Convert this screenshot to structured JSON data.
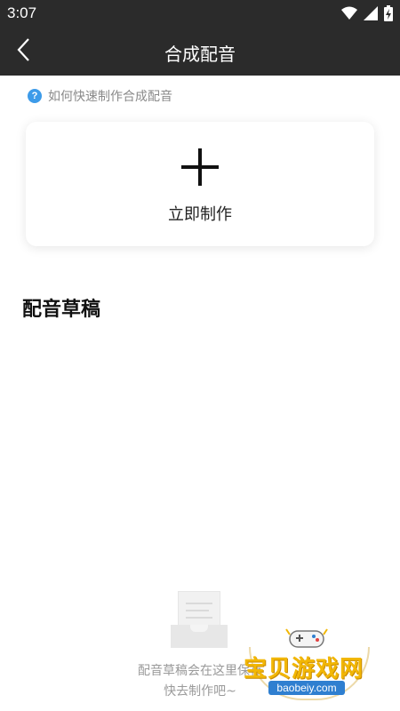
{
  "status_bar": {
    "time": "3:07",
    "icons": [
      "wifi-icon",
      "cellular-icon",
      "battery-charging-icon"
    ]
  },
  "app_bar": {
    "title": "合成配音",
    "back_icon": "back-arrow-icon"
  },
  "help": {
    "icon_glyph": "?",
    "text": "如何快速制作合成配音"
  },
  "create_card": {
    "icon": "plus-icon",
    "label": "立即制作"
  },
  "drafts": {
    "title": "配音草稿",
    "empty_line_1": "配音草稿会在这里保存",
    "empty_line_2": "快去制作吧~"
  },
  "watermark": {
    "text": "宝贝游戏网",
    "url": "baobeiy.com"
  },
  "colors": {
    "app_bar_bg": "#2b2b2b",
    "help_icon": "#3d9be9",
    "watermark_gold": "#f2b705",
    "watermark_blue": "#2f7fd0"
  }
}
